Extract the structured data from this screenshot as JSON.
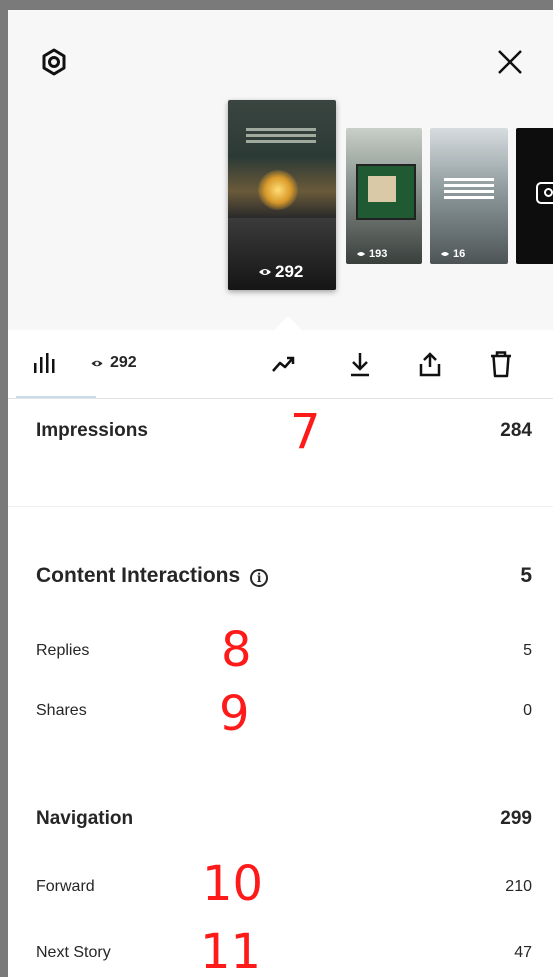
{
  "window": {
    "close_label": "×"
  },
  "stories": [
    {
      "views": "292",
      "selected": true
    },
    {
      "views": "193"
    },
    {
      "views": "16"
    },
    {
      "kind": "camera"
    }
  ],
  "toolbar": {
    "views_count": "292",
    "tools": [
      "promote-icon",
      "download-icon",
      "share-icon",
      "delete-icon"
    ]
  },
  "metrics": {
    "impressions": {
      "label": "Impressions",
      "value": "284"
    },
    "content_interactions": {
      "label": "Content Interactions",
      "value": "5",
      "info_symbol": "i",
      "items": [
        {
          "label": "Replies",
          "value": "5"
        },
        {
          "label": "Shares",
          "value": "0"
        }
      ]
    },
    "navigation": {
      "label": "Navigation",
      "value": "299",
      "items": [
        {
          "label": "Forward",
          "value": "210"
        },
        {
          "label": "Next Story",
          "value": "47"
        }
      ]
    }
  },
  "annotations": [
    "7",
    "8",
    "9",
    "10",
    "11"
  ],
  "colors": {
    "annotation": "#ff1a1a",
    "text": "#262626",
    "tab_underline": "#c9ddee"
  }
}
